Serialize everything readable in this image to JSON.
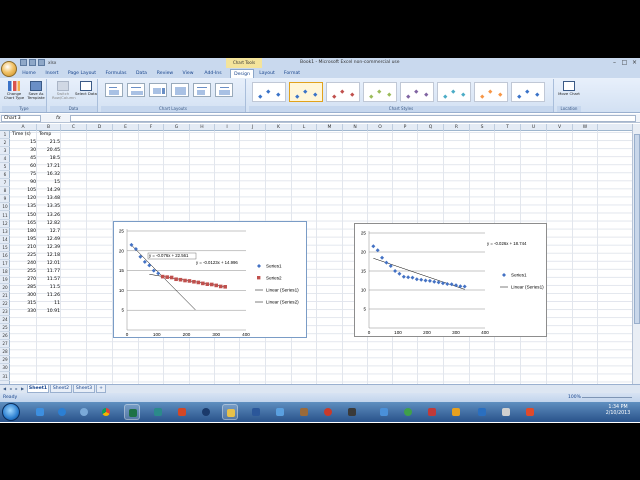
{
  "window": {
    "title": "Book1 - Microsoft Excel non-commercial use",
    "context_tab": "Chart Tools",
    "qat_doc": "xlsx"
  },
  "tabs": [
    "Home",
    "Insert",
    "Page Layout",
    "Formulas",
    "Data",
    "Review",
    "View",
    "Add-Ins",
    "Design",
    "Layout",
    "Format"
  ],
  "active_tab": "Design",
  "ribbon": {
    "type_group": {
      "label": "Type",
      "buttons": [
        "Change Chart Type",
        "Save As Template"
      ]
    },
    "data_group": {
      "label": "Data",
      "buttons": [
        "Switch Row/Column",
        "Select Data"
      ]
    },
    "layouts_group": {
      "label": "Chart Layouts"
    },
    "styles_group": {
      "label": "Chart Styles"
    },
    "location_group": {
      "label": "Location",
      "buttons": [
        "Move Chart"
      ]
    }
  },
  "formula_bar": {
    "name_box": "Chart 3",
    "fx": "fx",
    "formula": ""
  },
  "columns": [
    "A",
    "B",
    "C",
    "D",
    "E",
    "F",
    "G",
    "H",
    "I",
    "J",
    "K",
    "L",
    "M",
    "N",
    "O",
    "P",
    "Q",
    "R",
    "S",
    "T",
    "U",
    "V",
    "W"
  ],
  "rows": [
    "1",
    "2",
    "3",
    "4",
    "5",
    "6",
    "7",
    "8",
    "9",
    "10",
    "11",
    "12",
    "13",
    "14",
    "15",
    "16",
    "17",
    "18",
    "19",
    "20",
    "21",
    "22",
    "23",
    "24",
    "25",
    "26",
    "27",
    "28",
    "29",
    "30",
    "31"
  ],
  "sheet_data": {
    "headers": [
      "Time (s)",
      "Temp"
    ],
    "rows": [
      [
        "15",
        "21.5"
      ],
      [
        "30",
        "20.45"
      ],
      [
        "45",
        "18.5"
      ],
      [
        "60",
        "17.21"
      ],
      [
        "75",
        "16.32"
      ],
      [
        "90",
        "15"
      ],
      [
        "105",
        "14.29"
      ],
      [
        "120",
        "13.48"
      ],
      [
        "135",
        "13.35"
      ],
      [
        "150",
        "13.26"
      ],
      [
        "165",
        "12.82"
      ],
      [
        "180",
        "12.7"
      ],
      [
        "195",
        "12.49"
      ],
      [
        "210",
        "12.39"
      ],
      [
        "225",
        "12.18"
      ],
      [
        "240",
        "12.01"
      ],
      [
        "255",
        "11.77"
      ],
      [
        "270",
        "11.57"
      ],
      [
        "285",
        "11.5"
      ],
      [
        "300",
        "11.26"
      ],
      [
        "315",
        "11"
      ],
      [
        "330",
        "10.91"
      ]
    ]
  },
  "chart_data": [
    {
      "type": "scatter",
      "title": "",
      "xlim": [
        0,
        400
      ],
      "ylim": [
        0,
        25
      ],
      "xticks": [
        "0",
        "100",
        "200",
        "300",
        "400"
      ],
      "yticks": [
        "5",
        "10",
        "15",
        "20",
        "25"
      ],
      "legend_position": "right",
      "series": [
        {
          "name": "Series1",
          "marker": "diamond",
          "color": "#4472c4",
          "x": [
            15,
            30,
            45,
            60,
            75,
            90,
            105
          ],
          "y": [
            21.5,
            20.45,
            18.5,
            17.21,
            16.32,
            15,
            14.29
          ]
        },
        {
          "name": "Series2",
          "marker": "square",
          "color": "#c0504d",
          "x": [
            120,
            135,
            150,
            165,
            180,
            195,
            210,
            225,
            240,
            255,
            270,
            285,
            300,
            315,
            330
          ],
          "y": [
            13.48,
            13.35,
            13.26,
            12.82,
            12.7,
            12.49,
            12.39,
            12.18,
            12.01,
            11.77,
            11.57,
            11.5,
            11.26,
            11,
            10.91
          ]
        }
      ],
      "trendlines": [
        {
          "name": "Linear (Series1)",
          "slope": -0.076,
          "intercept": 22.561,
          "x_range": [
            15,
            230
          ],
          "label": "y = -0.076x + 22.561"
        },
        {
          "name": "Linear (Series2)",
          "slope": -0.0123,
          "intercept": 14.996,
          "x_range": [
            75,
            330
          ],
          "label": "y = -0.0123x + 14.996"
        }
      ],
      "legend": [
        "Series1",
        "Series2",
        "Linear (Series1)",
        "Linear (Series2)"
      ]
    },
    {
      "type": "scatter",
      "title": "",
      "xlim": [
        0,
        400
      ],
      "ylim": [
        0,
        25
      ],
      "xticks": [
        "0",
        "100",
        "200",
        "300",
        "400"
      ],
      "yticks": [
        "5",
        "10",
        "15",
        "20",
        "25"
      ],
      "legend_position": "right",
      "series": [
        {
          "name": "Series1",
          "marker": "diamond",
          "color": "#4472c4",
          "x": [
            15,
            30,
            45,
            60,
            75,
            90,
            105,
            120,
            135,
            150,
            165,
            180,
            195,
            210,
            225,
            240,
            255,
            270,
            285,
            300,
            315,
            330
          ],
          "y": [
            21.5,
            20.45,
            18.5,
            17.21,
            16.32,
            15,
            14.29,
            13.48,
            13.35,
            13.26,
            12.82,
            12.7,
            12.49,
            12.39,
            12.18,
            12.01,
            11.77,
            11.57,
            11.5,
            11.26,
            11,
            10.91
          ]
        }
      ],
      "trendlines": [
        {
          "name": "Linear (Series1)",
          "slope": -0.026,
          "intercept": 18.744,
          "x_range": [
            15,
            330
          ],
          "label": "y = -0.026x + 18.744"
        }
      ],
      "legend": [
        "Series1",
        "Linear (Series1)"
      ]
    }
  ],
  "sheet_tabs": [
    "Sheet1",
    "Sheet2",
    "Sheet3"
  ],
  "active_sheet": "Sheet1",
  "status": {
    "text": "Ready",
    "zoom": "100%"
  },
  "taskbar": {
    "time": "1:34 PM",
    "date": "2/10/2013"
  }
}
